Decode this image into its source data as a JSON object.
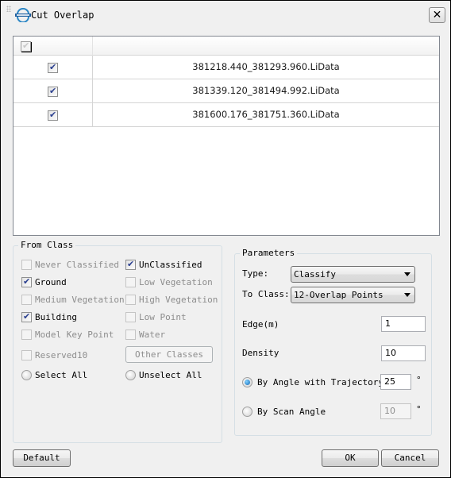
{
  "window": {
    "title": "Cut Overlap",
    "close_icon": "close-icon",
    "logo_icon": "lidar-app-logo"
  },
  "file_table": {
    "header_checkbox_checked": true,
    "header_checkbox_enabled": false,
    "rows": [
      {
        "checked": true,
        "name": "381218.440_381293.960.LiData"
      },
      {
        "checked": true,
        "name": "381339.120_381494.992.LiData"
      },
      {
        "checked": true,
        "name": "381600.176_381751.360.LiData"
      }
    ]
  },
  "from_class": {
    "title": "From Class",
    "classes": [
      {
        "label": "Never Classified",
        "checked": false,
        "enabled": false
      },
      {
        "label": "UnClassified",
        "checked": true,
        "enabled": true
      },
      {
        "label": "Ground",
        "checked": true,
        "enabled": true
      },
      {
        "label": "Low Vegetation",
        "checked": false,
        "enabled": false
      },
      {
        "label": "Medium Vegetation",
        "checked": false,
        "enabled": false
      },
      {
        "label": "High Vegetation",
        "checked": false,
        "enabled": false
      },
      {
        "label": "Building",
        "checked": true,
        "enabled": true
      },
      {
        "label": "Low Point",
        "checked": false,
        "enabled": false
      },
      {
        "label": "Model Key Point",
        "checked": false,
        "enabled": false
      },
      {
        "label": "Water",
        "checked": false,
        "enabled": false
      },
      {
        "label": "Reserved10",
        "checked": false,
        "enabled": false
      }
    ],
    "other_classes_label": "Other Classes",
    "select_all_label": "Select All",
    "unselect_all_label": "Unselect All"
  },
  "parameters": {
    "title": "Parameters",
    "type_label": "Type:",
    "type_value": "Classify",
    "to_class_label": "To Class:",
    "to_class_value": "12-Overlap Points",
    "edge_label": "Edge(m)",
    "edge_value": "1",
    "density_label": "Density",
    "density_value": "10",
    "angle_trajectory_label": "By Angle with Trajectory",
    "angle_trajectory_value": "25",
    "angle_trajectory_selected": true,
    "scan_angle_label": "By Scan Angle",
    "scan_angle_value": "10",
    "scan_angle_selected": false,
    "degree_symbol": "°"
  },
  "footer": {
    "default_label": "Default",
    "ok_label": "OK",
    "cancel_label": "Cancel"
  }
}
